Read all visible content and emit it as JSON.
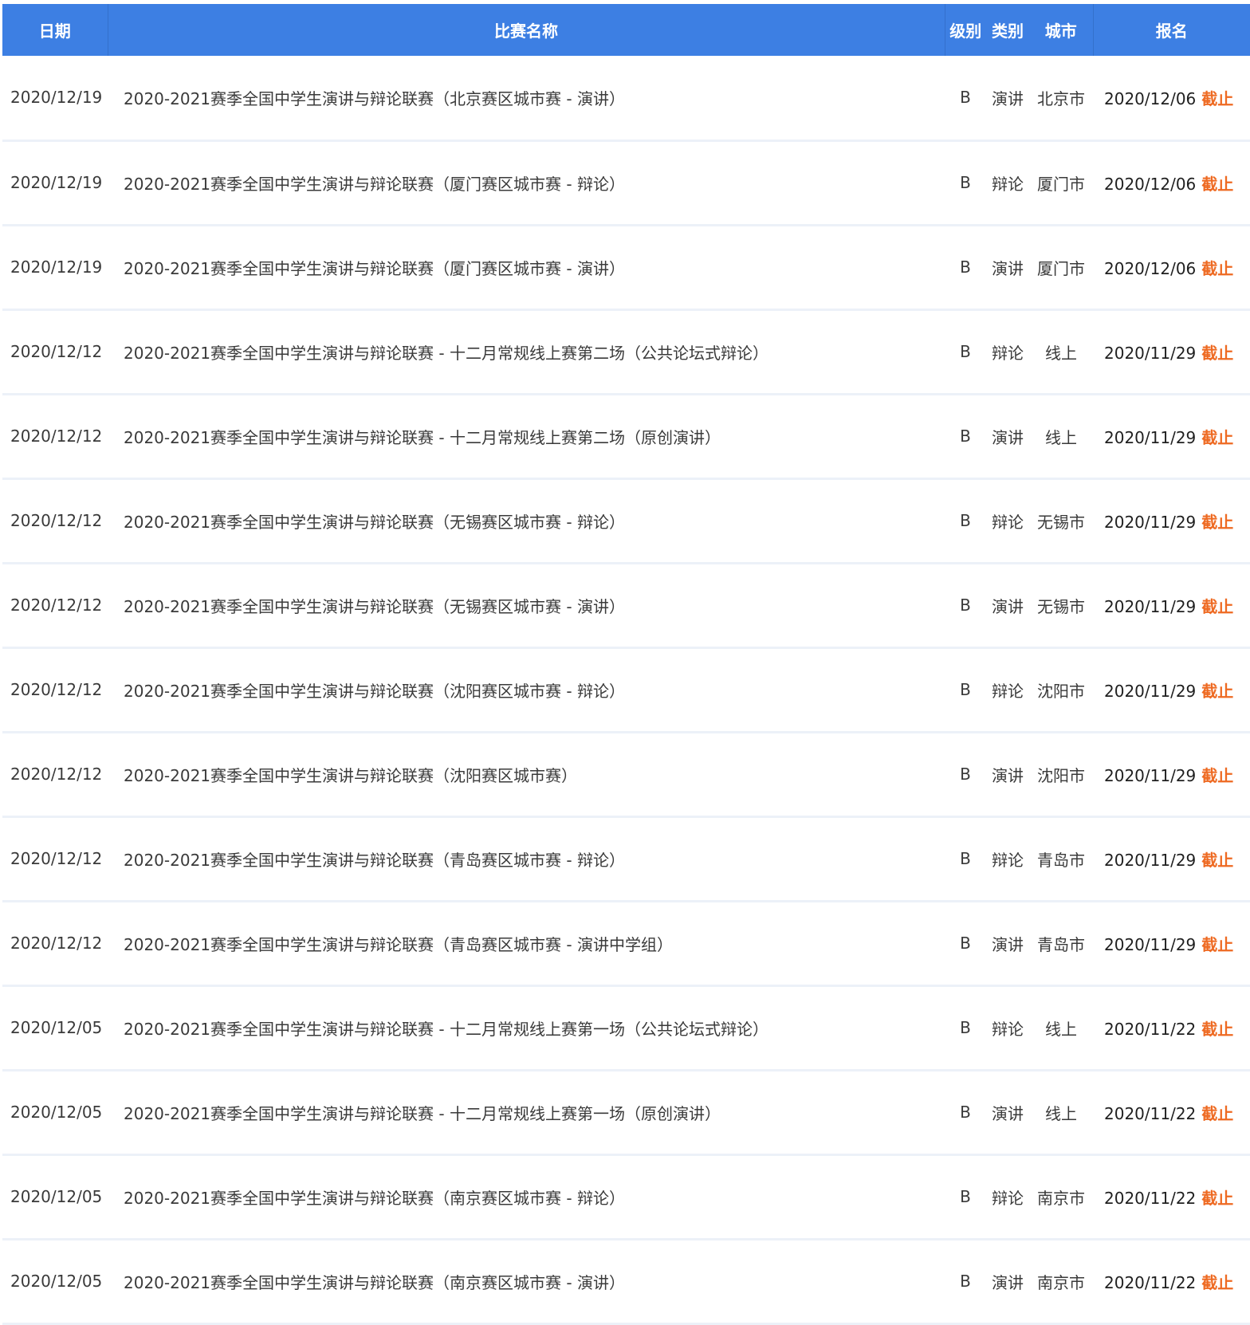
{
  "colors": {
    "header_bg": "#3d7fe3",
    "header_text": "#ffffff",
    "status_closed": "#ee6a22",
    "row_divider": "#ecf1f8"
  },
  "table": {
    "headers": {
      "date": "日期",
      "name": "比赛名称",
      "level": "级别",
      "category": "类别",
      "city": "城市",
      "registration": "报名"
    },
    "rows": [
      {
        "date": "2020/12/19",
        "name": "2020-2021赛季全国中学生演讲与辩论联赛（北京赛区城市赛 - 演讲）",
        "level": "B",
        "category": "演讲",
        "city": "北京市",
        "reg_date": "2020/12/06",
        "status": "截止"
      },
      {
        "date": "2020/12/19",
        "name": "2020-2021赛季全国中学生演讲与辩论联赛（厦门赛区城市赛 - 辩论）",
        "level": "B",
        "category": "辩论",
        "city": "厦门市",
        "reg_date": "2020/12/06",
        "status": "截止"
      },
      {
        "date": "2020/12/19",
        "name": "2020-2021赛季全国中学生演讲与辩论联赛（厦门赛区城市赛 - 演讲）",
        "level": "B",
        "category": "演讲",
        "city": "厦门市",
        "reg_date": "2020/12/06",
        "status": "截止"
      },
      {
        "date": "2020/12/12",
        "name": "2020-2021赛季全国中学生演讲与辩论联赛 - 十二月常规线上赛第二场（公共论坛式辩论）",
        "level": "B",
        "category": "辩论",
        "city": "线上",
        "reg_date": "2020/11/29",
        "status": "截止"
      },
      {
        "date": "2020/12/12",
        "name": "2020-2021赛季全国中学生演讲与辩论联赛 - 十二月常规线上赛第二场（原创演讲）",
        "level": "B",
        "category": "演讲",
        "city": "线上",
        "reg_date": "2020/11/29",
        "status": "截止"
      },
      {
        "date": "2020/12/12",
        "name": "2020-2021赛季全国中学生演讲与辩论联赛（无锡赛区城市赛 - 辩论）",
        "level": "B",
        "category": "辩论",
        "city": "无锡市",
        "reg_date": "2020/11/29",
        "status": "截止"
      },
      {
        "date": "2020/12/12",
        "name": "2020-2021赛季全国中学生演讲与辩论联赛（无锡赛区城市赛 - 演讲）",
        "level": "B",
        "category": "演讲",
        "city": "无锡市",
        "reg_date": "2020/11/29",
        "status": "截止"
      },
      {
        "date": "2020/12/12",
        "name": "2020-2021赛季全国中学生演讲与辩论联赛（沈阳赛区城市赛 - 辩论）",
        "level": "B",
        "category": "辩论",
        "city": "沈阳市",
        "reg_date": "2020/11/29",
        "status": "截止"
      },
      {
        "date": "2020/12/12",
        "name": "2020-2021赛季全国中学生演讲与辩论联赛（沈阳赛区城市赛）",
        "level": "B",
        "category": "演讲",
        "city": "沈阳市",
        "reg_date": "2020/11/29",
        "status": "截止"
      },
      {
        "date": "2020/12/12",
        "name": "2020-2021赛季全国中学生演讲与辩论联赛（青岛赛区城市赛 - 辩论）",
        "level": "B",
        "category": "辩论",
        "city": "青岛市",
        "reg_date": "2020/11/29",
        "status": "截止"
      },
      {
        "date": "2020/12/12",
        "name": "2020-2021赛季全国中学生演讲与辩论联赛（青岛赛区城市赛 - 演讲中学组）",
        "level": "B",
        "category": "演讲",
        "city": "青岛市",
        "reg_date": "2020/11/29",
        "status": "截止"
      },
      {
        "date": "2020/12/05",
        "name": "2020-2021赛季全国中学生演讲与辩论联赛 - 十二月常规线上赛第一场（公共论坛式辩论）",
        "level": "B",
        "category": "辩论",
        "city": "线上",
        "reg_date": "2020/11/22",
        "status": "截止"
      },
      {
        "date": "2020/12/05",
        "name": "2020-2021赛季全国中学生演讲与辩论联赛 - 十二月常规线上赛第一场（原创演讲）",
        "level": "B",
        "category": "演讲",
        "city": "线上",
        "reg_date": "2020/11/22",
        "status": "截止"
      },
      {
        "date": "2020/12/05",
        "name": "2020-2021赛季全国中学生演讲与辩论联赛（南京赛区城市赛 - 辩论）",
        "level": "B",
        "category": "辩论",
        "city": "南京市",
        "reg_date": "2020/11/22",
        "status": "截止"
      },
      {
        "date": "2020/12/05",
        "name": "2020-2021赛季全国中学生演讲与辩论联赛（南京赛区城市赛 - 演讲）",
        "level": "B",
        "category": "演讲",
        "city": "南京市",
        "reg_date": "2020/11/22",
        "status": "截止"
      }
    ]
  }
}
